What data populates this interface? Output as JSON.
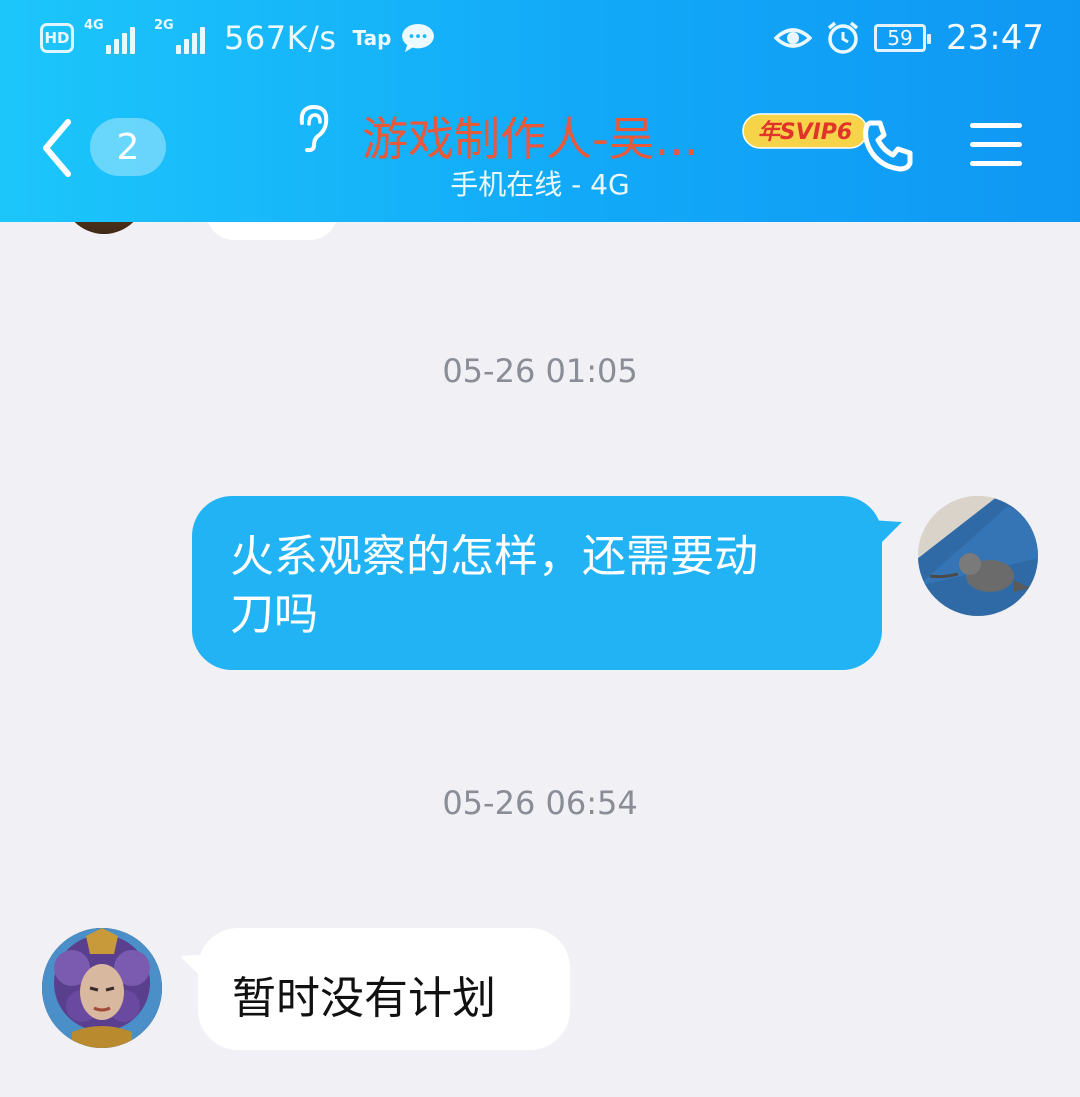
{
  "status_bar": {
    "hd_label": "HD",
    "network_1": "4G",
    "network_2": "2G",
    "speed": "567K/s",
    "tap_label": "Tap",
    "battery": "59",
    "time": "23:47"
  },
  "title_bar": {
    "unread_count": "2",
    "contact_name": "游戏制作人-吴...",
    "svip_badge": "年SVIP6",
    "status": "手机在线 - 4G"
  },
  "messages": [
    {
      "type": "timestamp",
      "text": "05-26 01:05"
    },
    {
      "type": "outgoing",
      "text_line1": "火系观察的怎样，还需要动",
      "text_line2": "刀吗"
    },
    {
      "type": "timestamp",
      "text": "05-26 06:54"
    },
    {
      "type": "incoming",
      "text": "暂时没有计划"
    }
  ],
  "colors": {
    "header_start": "#1cc6fb",
    "header_end": "#0f97f4",
    "contact_name": "#e8593a",
    "outgoing_bubble": "#22b3f5",
    "incoming_bubble": "#ffffff",
    "chat_background": "#f0f0f5",
    "svip_badge": "#f7d34a"
  },
  "icons": [
    "back-chevron-icon",
    "ear-icon",
    "phone-icon",
    "menu-icon",
    "eye-icon",
    "alarm-icon",
    "chat-bubble-icon"
  ]
}
